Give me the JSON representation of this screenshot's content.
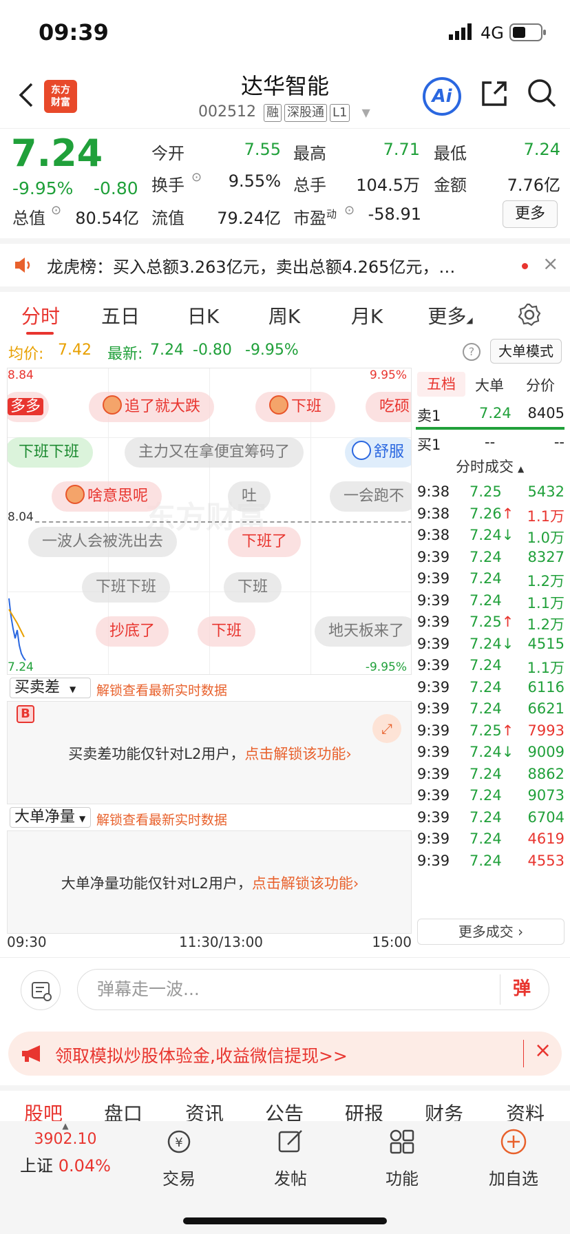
{
  "status": {
    "time": "09:39",
    "network": "4G"
  },
  "header": {
    "logo_line1": "东方",
    "logo_line2": "财富",
    "name": "达华智能",
    "code": "002512",
    "tags": [
      "融",
      "深股通",
      "L1"
    ],
    "ai_label": "Ai"
  },
  "quote": {
    "price": "7.24",
    "change_pct": "-9.95%",
    "change": "-0.80",
    "open_label": "今开",
    "open": "7.55",
    "high_label": "最高",
    "high": "7.71",
    "low_label": "最低",
    "low": "7.24",
    "turnover_label": "换手",
    "turnover": "9.55%",
    "volume_label": "总手",
    "volume": "104.5万",
    "amount_label": "金额",
    "amount": "7.76亿",
    "mcap_label": "总值",
    "mcap": "80.54亿",
    "float_label": "流值",
    "float": "79.24亿",
    "pe_label": "市盈",
    "pe_sup": "动",
    "pe": "-58.91",
    "more": "更多"
  },
  "news": {
    "text": "龙虎榜：买入总额3.263亿元，卖出总额4.265亿元，…"
  },
  "tabs": [
    "分时",
    "五日",
    "日K",
    "周K",
    "月K",
    "更多"
  ],
  "chart_hdr": {
    "avg_label": "均价:",
    "avg": "7.42",
    "latest_label": "最新:",
    "latest": "7.24",
    "latest_chg": "-0.80",
    "latest_pct": "-9.95%",
    "mode": "大单模式"
  },
  "chart": {
    "top_price": "8.84",
    "top_pct": "9.95%",
    "mid_price": "8.04",
    "bottom_price": "7.24",
    "bottom_pct": "-9.95%",
    "marker": "B",
    "danmaku": [
      {
        "text": "多多",
        "style": "red"
      },
      {
        "text": "追了就大跌",
        "style": "red",
        "emo": true
      },
      {
        "text": "下班",
        "style": "red",
        "emo": true
      },
      {
        "text": "吃硕",
        "style": "red"
      },
      {
        "text": "下班下班",
        "style": "green"
      },
      {
        "text": "主力又在拿便宜筹码了",
        "style": "gray"
      },
      {
        "text": "舒服",
        "style": "blue",
        "emo": true
      },
      {
        "text": "啥意思呢",
        "style": "red",
        "emo": true
      },
      {
        "text": "吐",
        "style": "gray"
      },
      {
        "text": "一会跑不",
        "style": "gray"
      },
      {
        "text": "一波人会被洗出去",
        "style": "gray"
      },
      {
        "text": "下班了",
        "style": "red"
      },
      {
        "text": "下班下班",
        "style": "gray"
      },
      {
        "text": "下班",
        "style": "gray"
      },
      {
        "text": "抄底了",
        "style": "red"
      },
      {
        "text": "下班",
        "style": "red"
      },
      {
        "text": "地天板来了",
        "style": "gray"
      }
    ]
  },
  "sub1": {
    "select": "买卖差",
    "unlock": "解锁查看最新实时数据",
    "msg": "买卖差功能仅针对L2用户，",
    "link": "点击解锁该功能›"
  },
  "sub2": {
    "select": "大单净量",
    "unlock": "解锁查看最新实时数据",
    "msg": "大单净量功能仅针对L2用户，",
    "link": "点击解锁该功能›"
  },
  "time_axis": [
    "09:30",
    "11:30/13:00",
    "15:00"
  ],
  "right_panel": {
    "tabs": [
      "五档",
      "大单",
      "分价"
    ],
    "sell1": {
      "label": "卖1",
      "price": "7.24",
      "vol": "8405"
    },
    "buy1": {
      "label": "买1",
      "price": "--",
      "vol": "--"
    },
    "trades_title": "分时成交",
    "trades": [
      {
        "t": "9:38",
        "p": "7.25",
        "arrow": "",
        "v": "5432",
        "pc": "green",
        "vc": "green"
      },
      {
        "t": "9:38",
        "p": "7.26",
        "arrow": "↑",
        "v": "1.1万",
        "pc": "green",
        "vc": "red"
      },
      {
        "t": "9:38",
        "p": "7.24",
        "arrow": "↓",
        "v": "1.0万",
        "pc": "green",
        "vc": "green"
      },
      {
        "t": "9:39",
        "p": "7.24",
        "arrow": "",
        "v": "8327",
        "pc": "green",
        "vc": "green"
      },
      {
        "t": "9:39",
        "p": "7.24",
        "arrow": "",
        "v": "1.2万",
        "pc": "green",
        "vc": "green"
      },
      {
        "t": "9:39",
        "p": "7.24",
        "arrow": "",
        "v": "1.1万",
        "pc": "green",
        "vc": "green"
      },
      {
        "t": "9:39",
        "p": "7.25",
        "arrow": "↑",
        "v": "1.2万",
        "pc": "green",
        "vc": "green"
      },
      {
        "t": "9:39",
        "p": "7.24",
        "arrow": "↓",
        "v": "4515",
        "pc": "green",
        "vc": "green"
      },
      {
        "t": "9:39",
        "p": "7.24",
        "arrow": "",
        "v": "1.1万",
        "pc": "green",
        "vc": "green"
      },
      {
        "t": "9:39",
        "p": "7.24",
        "arrow": "",
        "v": "6116",
        "pc": "green",
        "vc": "green"
      },
      {
        "t": "9:39",
        "p": "7.24",
        "arrow": "",
        "v": "6621",
        "pc": "green",
        "vc": "green"
      },
      {
        "t": "9:39",
        "p": "7.25",
        "arrow": "↑",
        "v": "7993",
        "pc": "green",
        "vc": "red"
      },
      {
        "t": "9:39",
        "p": "7.24",
        "arrow": "↓",
        "v": "9009",
        "pc": "green",
        "vc": "green"
      },
      {
        "t": "9:39",
        "p": "7.24",
        "arrow": "",
        "v": "8862",
        "pc": "green",
        "vc": "green"
      },
      {
        "t": "9:39",
        "p": "7.24",
        "arrow": "",
        "v": "9073",
        "pc": "green",
        "vc": "green"
      },
      {
        "t": "9:39",
        "p": "7.24",
        "arrow": "",
        "v": "6704",
        "pc": "green",
        "vc": "green"
      },
      {
        "t": "9:39",
        "p": "7.24",
        "arrow": "",
        "v": "4619",
        "pc": "green",
        "vc": "red"
      },
      {
        "t": "9:39",
        "p": "7.24",
        "arrow": "",
        "v": "4553",
        "pc": "green",
        "vc": "red"
      }
    ],
    "more": "更多成交 ›"
  },
  "danmaku_input": {
    "placeholder": "弹幕走一波...",
    "send": "弹"
  },
  "promo": {
    "text": "领取模拟炒股体验金,收益微信提现>>"
  },
  "bottom_tabs": [
    "股吧",
    "盘口",
    "资讯",
    "公告",
    "研报",
    "财务",
    "资料"
  ],
  "toolbar": {
    "index_value": "3902.10",
    "index_name": "上证",
    "index_pct": "0.04%",
    "items": [
      "交易",
      "发帖",
      "功能",
      "加自选"
    ]
  },
  "colors": {
    "up": "#e8352f",
    "down": "#20a03a",
    "accent": "#e8612c"
  }
}
